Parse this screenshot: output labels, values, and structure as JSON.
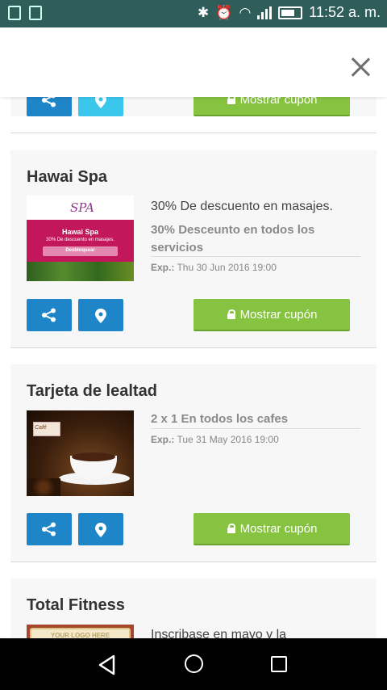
{
  "status_bar": {
    "time": "11:52 a. m."
  },
  "cards": [
    {
      "coupon_label": "Mostrar cupón"
    },
    {
      "title": "Hawai Spa",
      "thumb_text": {
        "logo": "SPA",
        "name": "Hawai Spa",
        "offer": "30% De descuento en masajes.",
        "button": "Desbloquear"
      },
      "offer_main": "30% De descuento en masajes.",
      "offer_sub": "30% Desceunto en todos los servicios",
      "expiry_label": "Exp.:",
      "expiry_value": "Thu 30 Jun 2016 19:00",
      "coupon_label": "Mostrar cupón"
    },
    {
      "title": "Tarjeta de lealtad",
      "thumb_text": {
        "logo": "Café"
      },
      "offer_sub": "2 x 1 En todos los cafes",
      "expiry_label": "Exp.:",
      "expiry_value": "Tue 31 May 2016 19:00",
      "coupon_label": "Mostrar cupón"
    },
    {
      "title": "Total Fitness",
      "thumb_text": {
        "logo": "YOUR LOGO HERE"
      },
      "offer_main": "Inscribase en mayo y la"
    }
  ],
  "icons": {
    "close": "close-icon",
    "share": "share-icon",
    "location": "location-pin-icon",
    "lock": "lock-open-icon",
    "back": "nav-back-icon",
    "home": "nav-home-icon",
    "recent": "nav-recent-icon"
  },
  "colors": {
    "status_bar": "#2f5d5a",
    "share_button": "#1f85c9",
    "map_button_partial": "#3bc6ec",
    "coupon_button": "#86c341",
    "card_bg": "#f7f7f7"
  }
}
